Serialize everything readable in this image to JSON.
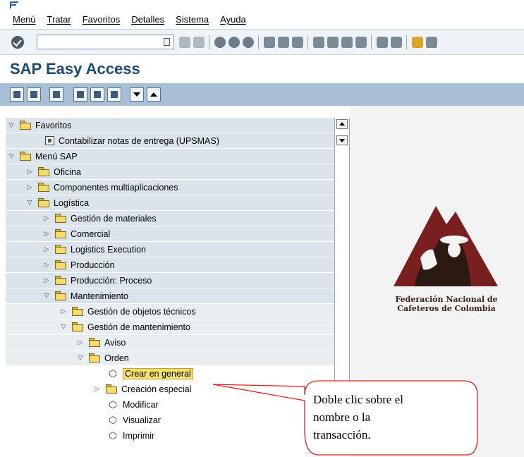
{
  "menu": {
    "items": [
      "Menú",
      "Tratar",
      "Favoritos",
      "Detalles",
      "Sistema",
      "Ayuda"
    ]
  },
  "toolbar": {
    "command_value": ""
  },
  "title": "SAP Easy Access",
  "tree": {
    "rows": [
      {
        "label": "Favoritos",
        "icon": "folder-open-icon",
        "expander": "open"
      },
      {
        "label": "Contabilizar notas de entrega (UPSMAS)",
        "icon": "transaction-doc-icon",
        "expander": "none"
      },
      {
        "label": "Menú SAP",
        "icon": "folder-open-icon",
        "expander": "open"
      },
      {
        "label": "Oficina",
        "icon": "folder-icon",
        "expander": "closed"
      },
      {
        "label": "Componentes multiaplicaciones",
        "icon": "folder-icon",
        "expander": "closed"
      },
      {
        "label": "Logística",
        "icon": "folder-open-icon",
        "expander": "open"
      },
      {
        "label": "Gestión de materiales",
        "icon": "folder-icon",
        "expander": "closed"
      },
      {
        "label": "Comercial",
        "icon": "folder-icon",
        "expander": "closed"
      },
      {
        "label": "Logistics Execution",
        "icon": "folder-icon",
        "expander": "closed"
      },
      {
        "label": "Producción",
        "icon": "folder-icon",
        "expander": "closed"
      },
      {
        "label": "Producción: Proceso",
        "icon": "folder-icon",
        "expander": "closed"
      },
      {
        "label": "Mantenimiento",
        "icon": "folder-open-icon",
        "expander": "open"
      },
      {
        "label": "Gestión de objetos técnicos",
        "icon": "folder-icon",
        "expander": "closed"
      },
      {
        "label": "Gestión de mantenimiento",
        "icon": "folder-open-icon",
        "expander": "open"
      },
      {
        "label": "Aviso",
        "icon": "folder-icon",
        "expander": "closed"
      },
      {
        "label": "Orden",
        "icon": "folder-open-icon",
        "expander": "open"
      },
      {
        "label": "Crear en general",
        "icon": "transaction-cube-icon",
        "expander": "none",
        "selected": true
      },
      {
        "label": "Creación especial",
        "icon": "folder-icon",
        "expander": "closed"
      },
      {
        "label": "Modificar",
        "icon": "transaction-cube-icon",
        "expander": "none"
      },
      {
        "label": "Visualizar",
        "icon": "transaction-cube-icon",
        "expander": "none"
      },
      {
        "label": "Imprimir",
        "icon": "transaction-cube-icon",
        "expander": "none"
      }
    ]
  },
  "logo": {
    "line1": "Federación Nacional de",
    "line2": "Cafeteros de Colombia",
    "registered": "®",
    "colors": {
      "mountain": "#7a1f1f",
      "figure": "#2a1a12"
    }
  },
  "callout": {
    "line1": "Doble clic sobre el",
    "line2": "nombre o la",
    "line3": "transacción.",
    "border_color": "#e02020"
  }
}
